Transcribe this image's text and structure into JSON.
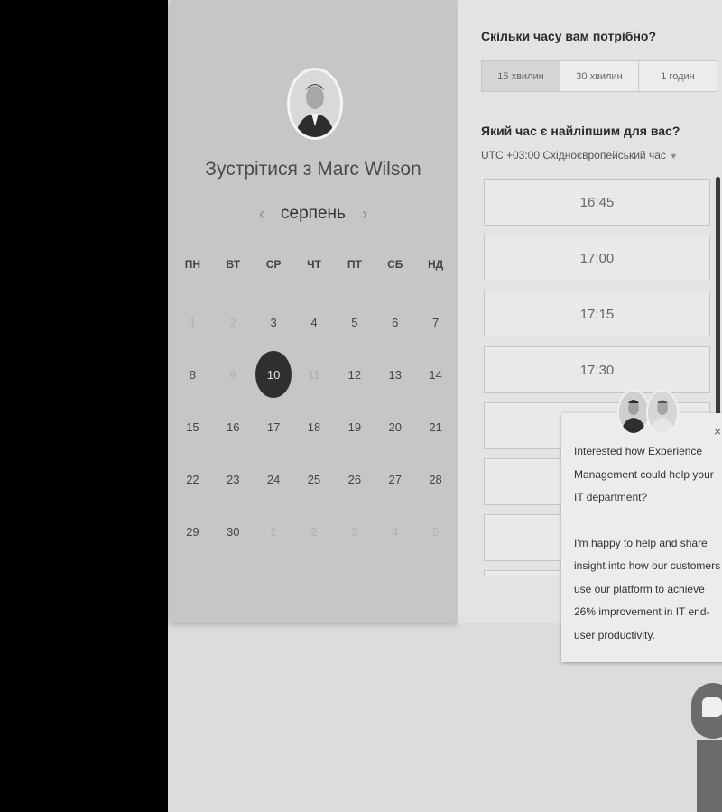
{
  "booking": {
    "title": "Зустрітися з Marc Wilson",
    "month": "серпень",
    "prev_arrow": "‹",
    "next_arrow": "›",
    "weekdays": [
      "ПН",
      "ВТ",
      "СР",
      "ЧТ",
      "ПТ",
      "СБ",
      "НД"
    ],
    "days": [
      {
        "label": "1",
        "state": "disabled"
      },
      {
        "label": "2",
        "state": "disabled"
      },
      {
        "label": "3",
        "state": "available"
      },
      {
        "label": "4",
        "state": "available"
      },
      {
        "label": "5",
        "state": "available"
      },
      {
        "label": "6",
        "state": "available"
      },
      {
        "label": "7",
        "state": "available"
      },
      {
        "label": "8",
        "state": "available"
      },
      {
        "label": "9",
        "state": "disabled"
      },
      {
        "label": "10",
        "state": "selected"
      },
      {
        "label": "11",
        "state": "disabled"
      },
      {
        "label": "12",
        "state": "available"
      },
      {
        "label": "13",
        "state": "available"
      },
      {
        "label": "14",
        "state": "available"
      },
      {
        "label": "15",
        "state": "available"
      },
      {
        "label": "16",
        "state": "available"
      },
      {
        "label": "17",
        "state": "available"
      },
      {
        "label": "18",
        "state": "available"
      },
      {
        "label": "19",
        "state": "available"
      },
      {
        "label": "20",
        "state": "available"
      },
      {
        "label": "21",
        "state": "available"
      },
      {
        "label": "22",
        "state": "available"
      },
      {
        "label": "23",
        "state": "available"
      },
      {
        "label": "24",
        "state": "available"
      },
      {
        "label": "25",
        "state": "available"
      },
      {
        "label": "26",
        "state": "available"
      },
      {
        "label": "27",
        "state": "available"
      },
      {
        "label": "28",
        "state": "available"
      },
      {
        "label": "29",
        "state": "available"
      },
      {
        "label": "30",
        "state": "available"
      },
      {
        "label": "1",
        "state": "disabled"
      },
      {
        "label": "2",
        "state": "disabled"
      },
      {
        "label": "3",
        "state": "disabled"
      },
      {
        "label": "4",
        "state": "disabled"
      },
      {
        "label": "5",
        "state": "disabled"
      }
    ]
  },
  "duration": {
    "question": "Скільки часу вам потрібно?",
    "options": [
      "15 хвилин",
      "30 хвилин",
      "1 годин"
    ],
    "selected_index": 0
  },
  "time": {
    "question": "Який час є найліпшим для вас?",
    "timezone": "UTC +03:00 Східноєвропейський час",
    "slots": [
      "16:45",
      "17:00",
      "17:15",
      "17:30",
      "",
      "",
      "",
      ""
    ]
  },
  "chat": {
    "message_1": "Interested how Experience Management could help your IT department?",
    "message_2": "I'm happy to help and share insight into how our customers use our platform to achieve 26% improvement in IT end-user productivity.",
    "close_label": "×"
  },
  "icons": {
    "host_avatar": "avatar-icon",
    "agent_avatars": "avatar-icon",
    "launcher": "chat-bubble-icon",
    "tz_caret": "caret-down-icon"
  },
  "colors": {
    "selected_day": "#2f2f2f",
    "panel_left": "#c6c6c6",
    "panel_right": "#e3e3e3"
  }
}
